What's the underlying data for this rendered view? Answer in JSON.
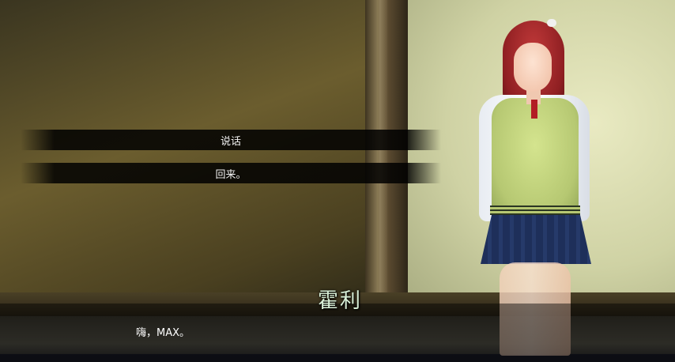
{
  "choices": [
    {
      "label": "说话"
    },
    {
      "label": "回来。"
    }
  ],
  "dialogue": {
    "speaker": "霍利",
    "text": "嗨，MAX。"
  },
  "colors": {
    "speaker_text": "#d9f0d8",
    "choice_bar": "#000000",
    "dialog_text": "#ffffff"
  }
}
